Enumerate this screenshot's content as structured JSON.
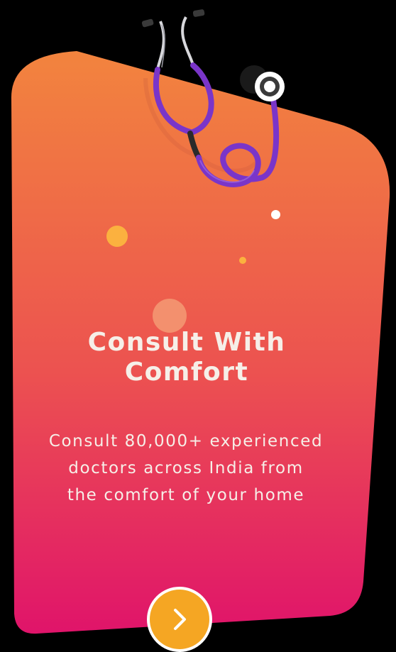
{
  "card": {
    "title_line1": "Consult With",
    "title_line2": "Comfort",
    "description_line1": "Consult 80,000+ experienced",
    "description_line2": "doctors across India from",
    "description_line3": "the comfort of your home"
  },
  "colors": {
    "background": "#000000",
    "gradient_top": "#f2843e",
    "gradient_bottom": "#e0146a",
    "accent_yellow": "#f5a623",
    "stethoscope_tube": "#7a35c9",
    "text": "#f6efe8"
  },
  "illustration": {
    "icon": "stethoscope-icon"
  },
  "next_button": {
    "icon": "chevron-right-icon"
  }
}
